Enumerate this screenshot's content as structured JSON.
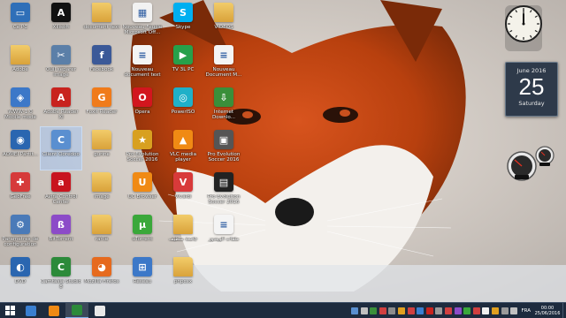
{
  "desktop": {
    "icons": [
      {
        "label": "Ce PC",
        "name": "this-pc-icon",
        "color": "#2f6fb8",
        "glyph": "▭"
      },
      {
        "label": "Xilisoft",
        "name": "xilisoft-icon",
        "color": "#111111",
        "glyph": "A"
      },
      {
        "label": "document text",
        "name": "folder-icon",
        "color": "#e8b64c",
        "glyph": ""
      },
      {
        "label": "Nouveau Feuille Microsoft Off...",
        "name": "excel-file-icon",
        "color": "#f2f2f2",
        "glyph": "▦"
      },
      {
        "label": "Skype",
        "name": "skype-icon",
        "color": "#00aff0",
        "glyph": "S"
      },
      {
        "label": "VIDEOS",
        "name": "folder-icon",
        "color": "#e8b64c",
        "glyph": ""
      },
      {
        "label": "Adobe",
        "name": "folder-icon",
        "color": "#e8b64c",
        "glyph": ""
      },
      {
        "label": "Ouil séparer image",
        "name": "app-icon",
        "color": "#5b7fa8",
        "glyph": "✂"
      },
      {
        "label": "Facebook",
        "name": "facebook-icon",
        "color": "#3b5998",
        "glyph": "f"
      },
      {
        "label": "Nouveau document text",
        "name": "text-file-icon",
        "color": "#f4f4f4",
        "glyph": "≡"
      },
      {
        "label": "TV 3L PC",
        "name": "tv-app-icon",
        "color": "#27a04a",
        "glyph": "▶"
      },
      {
        "label": "Nouveau Document M...",
        "name": "word-file-icon",
        "color": "#f4f4f4",
        "glyph": "≡"
      },
      {
        "label": "WWW-1.0 Mobile mode",
        "name": "network-icon",
        "color": "#3c78c8",
        "glyph": "◈"
      },
      {
        "label": "Adobe Reader XI",
        "name": "adobe-reader-icon",
        "color": "#c8231e",
        "glyph": "A"
      },
      {
        "label": "Foxit Reader",
        "name": "foxit-reader-icon",
        "color": "#f07b1a",
        "glyph": "G"
      },
      {
        "label": "Opera",
        "name": "opera-icon",
        "color": "#d2161e",
        "glyph": "O"
      },
      {
        "label": "PowerISO",
        "name": "poweriso-icon",
        "color": "#1fb0c8",
        "glyph": "◎"
      },
      {
        "label": "Internet Downlo...",
        "name": "internet-download-icon",
        "color": "#3a8f3a",
        "glyph": "⇩"
      },
      {
        "label": "AOMEI Partit...",
        "name": "aomei-icon",
        "color": "#2a66b0",
        "glyph": "◉"
      },
      {
        "label": "Client Ooredoo",
        "name": "ooredoo-client-icon",
        "color": "#5a8fd0",
        "glyph": "C"
      },
      {
        "label": "gurine",
        "name": "folder-icon",
        "color": "#e8b64c",
        "glyph": ""
      },
      {
        "label": "Pro Evolution Soccer 2016",
        "name": "pes-2016-icon",
        "color": "#d8a020",
        "glyph": "★"
      },
      {
        "label": "VLC media player",
        "name": "vlc-icon",
        "color": "#f08a14",
        "glyph": "▲"
      },
      {
        "label": "Pro Evolution Soccer 2016",
        "name": "pes-game-icon",
        "color": "#555555",
        "glyph": "▣"
      },
      {
        "label": "GeoFree",
        "name": "geofree-icon",
        "color": "#d63a3a",
        "glyph": "✚"
      },
      {
        "label": "Avira Control Center",
        "name": "avira-icon",
        "color": "#c8141e",
        "glyph": "a"
      },
      {
        "label": "image",
        "name": "folder-icon",
        "color": "#e8b64c",
        "glyph": ""
      },
      {
        "label": "UC Browser",
        "name": "uc-browser-icon",
        "color": "#f08a14",
        "glyph": "U"
      },
      {
        "label": "Vivaldi",
        "name": "vivaldi-icon",
        "color": "#d83a3a",
        "glyph": "V"
      },
      {
        "label": "Pro Evolution Soccer 2016",
        "name": "pes-launcher-icon",
        "color": "#222222",
        "glyph": "▤"
      },
      {
        "label": "Paramètres de configuration",
        "name": "settings-file-icon",
        "color": "#4a7ab8",
        "glyph": "⚙"
      },
      {
        "label": "BitTorrent",
        "name": "bittorrent-icon",
        "color": "#8c4bc8",
        "glyph": "ß"
      },
      {
        "label": "rarlie",
        "name": "folder-icon",
        "color": "#e8b64c",
        "glyph": ""
      },
      {
        "label": "uTorrent",
        "name": "utorrent-icon",
        "color": "#3aa83a",
        "glyph": "µ"
      },
      {
        "label": "جامعة سطيف",
        "name": "folder-icon",
        "color": "#e8b64c",
        "glyph": ""
      },
      {
        "label": "ملفات الويندوز",
        "name": "text-file-icon",
        "color": "#f4f4f4",
        "glyph": "≡"
      },
      {
        "label": "DVD",
        "name": "dvd-icon",
        "color": "#2a66b0",
        "glyph": "◐"
      },
      {
        "label": "Camtasia Studio 8",
        "name": "camtasia-icon",
        "color": "#2c8a3a",
        "glyph": "C"
      },
      {
        "label": "Mozilla Firefox",
        "name": "firefox-icon",
        "color": "#e66a1e",
        "glyph": "◕"
      },
      {
        "label": "Réseau",
        "name": "network-icon",
        "color": "#3c78c8",
        "glyph": "⊞"
      },
      {
        "label": "phpcxx",
        "name": "folder-icon",
        "color": "#e8b64c",
        "glyph": ""
      }
    ]
  },
  "gadgets": {
    "clock": {
      "hour": 12,
      "minute": 0
    },
    "calendar": {
      "month": "June 2016",
      "day": "25",
      "weekday": "Saturday"
    }
  },
  "taskbar": {
    "apps": [
      {
        "name": "start-menu-app",
        "color": "#3a7fd0"
      },
      {
        "name": "uc-browser-taskbar",
        "color": "#f08a14"
      },
      {
        "name": "camtasia-taskbar",
        "color": "#2c8a3a"
      },
      {
        "name": "camtasia-recorder-taskbar",
        "color": "#e8e8e8"
      }
    ],
    "tray_icons": [
      "#5a8fd0",
      "#c0c0c0",
      "#3a8f3a",
      "#d04040",
      "#8c8c8c",
      "#e0a020",
      "#d04040",
      "#3a7fd0",
      "#c8231e",
      "#9a9a9a",
      "#d04040",
      "#8c4bc8",
      "#3aa83a",
      "#d04040",
      "#f0f0f0",
      "#e0a020",
      "#9a9a9a",
      "#c0c0c0"
    ],
    "language": "FRA",
    "time": "00:00",
    "date": "25/06/2016"
  }
}
